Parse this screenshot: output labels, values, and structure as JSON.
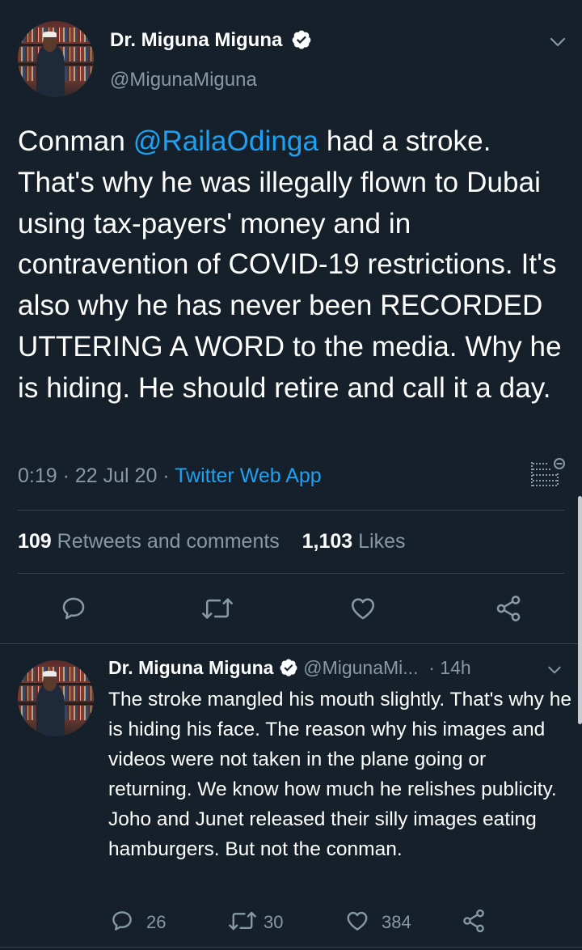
{
  "main_tweet": {
    "author_name": "Dr. Miguna Miguna",
    "handle": "@MigunaMiguna",
    "body_prefix": "Conman ",
    "mention": "@RailaOdinga",
    "body_rest": " had a stroke. That's why he was illegally flown to Dubai using tax-payers' money and in contravention of COVID-19 restrictions. It's also why he has never been RECORDED UTTERING A WORD to the media. Why he is hiding. He should retire and call it a day.",
    "time": "0:19",
    "sep1": " · ",
    "date": "22 Jul 20",
    "sep2": " · ",
    "source": "Twitter Web App",
    "retweets_count": "109",
    "retweets_label": "Retweets and comments",
    "likes_count": "1,103",
    "likes_label": "Likes"
  },
  "reply_tweet": {
    "author_name": "Dr. Miguna Miguna",
    "handle": "@MigunaMi...",
    "time": "· 14h",
    "body": "The stroke mangled his mouth slightly. That's why he is hiding his face. The reason why his images and videos were not taken in the plane going or returning. We know how much he relishes publicity. Joho and Junet released their silly images eating hamburgers. But not the conman.",
    "reply_count": "26",
    "retweet_count": "30",
    "like_count": "384"
  },
  "colors": {
    "background": "#15202b",
    "accent": "#1da1f2",
    "secondary_text": "#8899a6",
    "divider": "#38444d"
  },
  "icons": [
    "verified-badge-icon",
    "chevron-down-icon",
    "analytics-icon",
    "reply-icon",
    "retweet-icon",
    "like-icon",
    "share-icon"
  ]
}
